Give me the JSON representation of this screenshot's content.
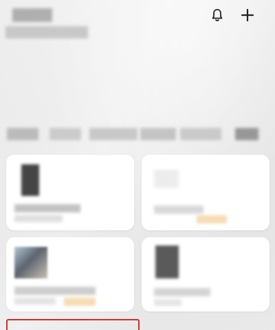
{
  "header": {
    "title": "",
    "subtitle": "",
    "bell_icon": "bell-icon",
    "add_icon": "plus-icon"
  },
  "tabs": [
    "",
    "",
    "",
    "",
    "",
    ""
  ],
  "cards": [
    {
      "title": "",
      "tag": ""
    },
    {
      "title": "",
      "tag": ""
    },
    {
      "title": "",
      "tag": ""
    },
    {
      "title": "",
      "tag": ""
    }
  ],
  "colors": {
    "highlight": "#d42a2a",
    "tag_background": "#f6dcb5",
    "card_background": "#ffffff"
  }
}
